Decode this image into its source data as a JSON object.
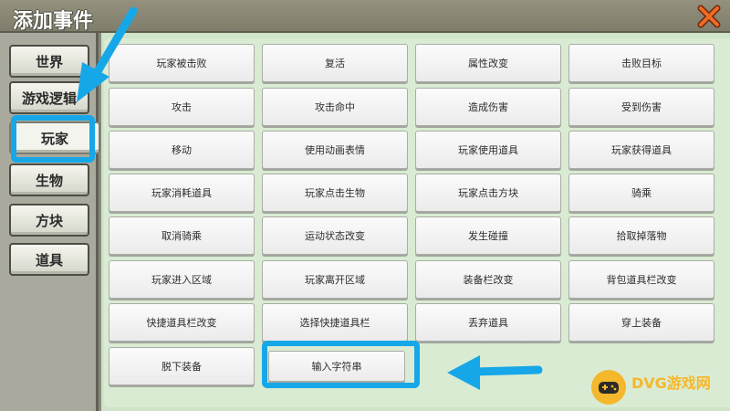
{
  "dialog": {
    "title": "添加事件",
    "close_icon": "close-x-icon"
  },
  "sidebar": {
    "items": [
      {
        "label": "世界"
      },
      {
        "label": "游戏逻辑"
      },
      {
        "label": "玩家",
        "selected": true
      },
      {
        "label": "生物"
      },
      {
        "label": "方块"
      },
      {
        "label": "道具"
      }
    ]
  },
  "events": [
    "玩家被击败",
    "复活",
    "属性改变",
    "击败目标",
    "攻击",
    "攻击命中",
    "造成伤害",
    "受到伤害",
    "移动",
    "使用动画表情",
    "玩家使用道具",
    "玩家获得道具",
    "玩家消耗道具",
    "玩家点击生物",
    "玩家点击方块",
    "骑乘",
    "取消骑乘",
    "运动状态改变",
    "发生碰撞",
    "拾取掉落物",
    "玩家进入区域",
    "玩家离开区域",
    "装备栏改变",
    "背包道具栏改变",
    "快捷道具栏改变",
    "选择快捷道具栏",
    "丢弃道具",
    "穿上装备",
    "脱下装备",
    "输入字符串"
  ],
  "watermark": {
    "name": "DVG游戏网",
    "url": "WWW.DSE.TV"
  },
  "colors": {
    "highlight": "#16a7e8",
    "watermark": "#f5b72c"
  }
}
